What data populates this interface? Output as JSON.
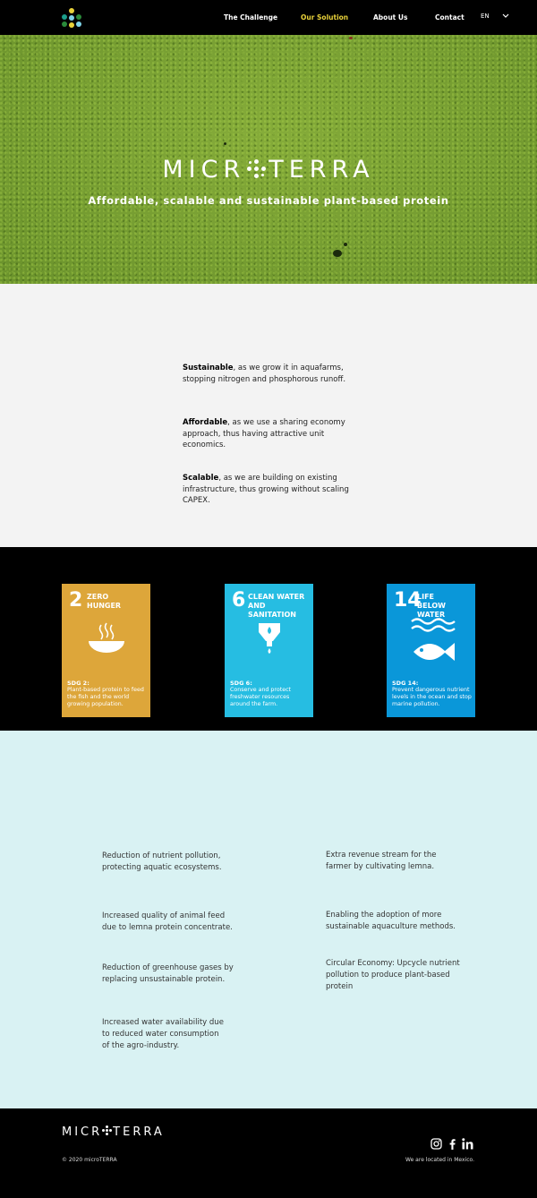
{
  "brand": {
    "name_left": "MICR",
    "name_right": "TERRA",
    "colors": {
      "yellow": "#e9d23a",
      "teal": "#1c9e8a",
      "light_blue": "#7fd3e8",
      "green": "#2a8a3a"
    }
  },
  "nav": {
    "items": [
      {
        "label": "The Challenge"
      },
      {
        "label": "Our Solution",
        "active": true
      },
      {
        "label": "About Us"
      },
      {
        "label": "Contact"
      }
    ],
    "language": "EN"
  },
  "hero": {
    "tagline": "Affordable, scalable and sustainable plant-based protein"
  },
  "benefits": [
    {
      "title": "Sustainable",
      "text": ", as we grow it in aquafarms, stopping nitrogen and phosphorous runoff."
    },
    {
      "title": "Affordable",
      "text": ", as we use a sharing economy approach, thus having attractive unit economics."
    },
    {
      "title": "Scalable",
      "text": ", as we are building on existing infrastructure, thus growing without scaling CAPEX."
    }
  ],
  "sdg_cards": [
    {
      "number": "2",
      "title_line1": "ZERO",
      "title_line2": "HUNGER",
      "label": "SDG 2:",
      "description": "Plant-based protein to feed the fish and the world growing population.",
      "color": "#dda63a",
      "icon": "bowl-icon"
    },
    {
      "number": "6",
      "title_line1": "CLEAN WATER",
      "title_line2": "AND SANITATION",
      "label": "SDG 6:",
      "description": "Conserve and protect freshwater resources around the farm.",
      "color": "#26bde2",
      "icon": "water-drop-icon"
    },
    {
      "number": "14",
      "title_line1": "LIFE",
      "title_line2": "BELOW WATER",
      "label": "SDG 14:",
      "description": "Prevent dangerous nutrient levels in the ocean and stop marine pollution.",
      "color": "#0a97d9",
      "icon": "fish-icon"
    }
  ],
  "impacts_left": [
    "Reduction of nutrient pollution, protecting aquatic ecosystems.",
    "Increased quality of animal feed due to lemna protein concentrate.",
    "Reduction of greenhouse gases by replacing unsustainable protein.",
    "Increased water availability due to reduced water consumption of the agro-industry."
  ],
  "impacts_right": [
    "Extra revenue stream for the farmer by cultivating lemna.",
    "Enabling the adoption of more sustainable aquaculture methods.",
    "Circular Economy: Upcycle nutrient pollution to produce plant-based protein"
  ],
  "footer": {
    "copyright": "© 2020 microTERRA",
    "location": "We are located in Mexico.",
    "social": [
      "instagram-icon",
      "facebook-icon",
      "linkedin-icon"
    ]
  }
}
